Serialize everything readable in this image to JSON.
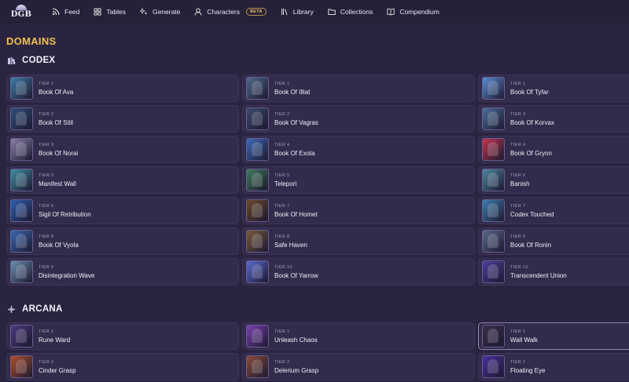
{
  "logo": {
    "text": "DGB"
  },
  "nav": [
    {
      "label": "Feed",
      "icon": "rss-icon"
    },
    {
      "label": "Tables",
      "icon": "grid-icon"
    },
    {
      "label": "Generate",
      "icon": "sparkle-icon"
    },
    {
      "label": "Characters",
      "icon": "user-icon",
      "badge": "BETA"
    },
    {
      "label": "Library",
      "icon": "library-icon"
    },
    {
      "label": "Collections",
      "icon": "folder-icon"
    },
    {
      "label": "Compendium",
      "icon": "book-icon"
    }
  ],
  "page_title": "DOMAINS",
  "sections": [
    {
      "title": "CODEX",
      "icon": "book-stack-icon",
      "cards": [
        {
          "tier": "TIER 1",
          "name": "Book Of Ava",
          "thumb": "#3d7fa6"
        },
        {
          "tier": "TIER 1",
          "name": "Book Of Illiat",
          "thumb": "#4e6a8a"
        },
        {
          "tier": "TIER 1",
          "name": "Book Of Tyfar",
          "thumb": "#5a8ed6"
        },
        {
          "tier": "TIER 2",
          "name": "Book Of Sitil",
          "thumb": "#2f4f7a"
        },
        {
          "tier": "TIER 2",
          "name": "Book Of Vagras",
          "thumb": "#3a4a6a"
        },
        {
          "tier": "TIER 3",
          "name": "Book Of Korvax",
          "thumb": "#4a6f9a"
        },
        {
          "tier": "TIER 3",
          "name": "Book Of Norai",
          "thumb": "#8a7fa8"
        },
        {
          "tier": "TIER 4",
          "name": "Book Of Exota",
          "thumb": "#3c69b8"
        },
        {
          "tier": "TIER 4",
          "name": "Book Of Grynn",
          "thumb": "#c2344e"
        },
        {
          "tier": "TIER 5",
          "name": "Manifest Wall",
          "thumb": "#3f8fa3"
        },
        {
          "tier": "TIER 5",
          "name": "Teleport",
          "thumb": "#3f7a5a"
        },
        {
          "tier": "TIER 6",
          "name": "Banish",
          "thumb": "#4f87a0"
        },
        {
          "tier": "TIER 6",
          "name": "Sigil Of Retribution",
          "thumb": "#2f5fb0"
        },
        {
          "tier": "TIER 7",
          "name": "Book Of Homet",
          "thumb": "#6a4a2a"
        },
        {
          "tier": "TIER 7",
          "name": "Codex Touched",
          "thumb": "#3d7fb0"
        },
        {
          "tier": "TIER 8",
          "name": "Book Of Vyola",
          "thumb": "#3a68b0"
        },
        {
          "tier": "TIER 8",
          "name": "Safe Haven",
          "thumb": "#7a5a3a"
        },
        {
          "tier": "TIER 9",
          "name": "Book Of Ronin",
          "thumb": "#5a6a8a"
        },
        {
          "tier": "TIER 9",
          "name": "Disintegration Wave",
          "thumb": "#6a8fb0"
        },
        {
          "tier": "TIER 10",
          "name": "Book Of Yarrow",
          "thumb": "#5a6ad0"
        },
        {
          "tier": "TIER 10",
          "name": "Transcendent Union",
          "thumb": "#4a3f9a"
        }
      ]
    },
    {
      "title": "ARCANA",
      "icon": "compass-star-icon",
      "cards": [
        {
          "tier": "TIER 1",
          "name": "Rune Ward",
          "thumb": "#4a3a7a"
        },
        {
          "tier": "TIER 1",
          "name": "Unleash Chaos",
          "thumb": "#7a3fb0"
        },
        {
          "tier": "TIER 1",
          "name": "Wall Walk",
          "thumb": "#3a2f4a",
          "selected": true
        },
        {
          "tier": "TIER 2",
          "name": "Cinder Grasp",
          "thumb": "#b0502a"
        },
        {
          "tier": "TIER 2",
          "name": "Delerium Grasp",
          "thumb": "#8a4a3a"
        },
        {
          "tier": "TIER 2",
          "name": "Floating Eye",
          "thumb": "#4a2f9a"
        }
      ]
    }
  ]
}
